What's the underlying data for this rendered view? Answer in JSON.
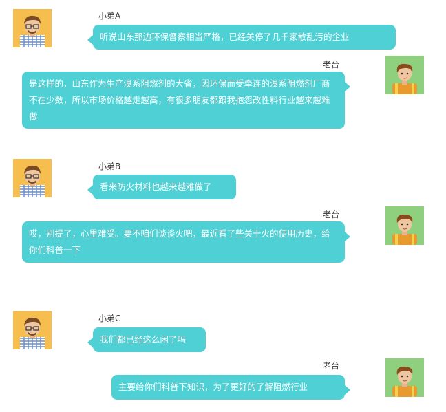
{
  "colors": {
    "bubble": "#4fd0d4",
    "text": "#ffffff",
    "name": "#333333",
    "avatar_bg_left": "#f5be4f",
    "avatar_bg_right": "#8fd07e"
  },
  "messages": [
    {
      "sender": "小弟A",
      "side": "left",
      "avatar": "young-man-glasses-avatar",
      "text": "听说山东那边环保督察相当严格，已经关停了几千家散乱污的企业"
    },
    {
      "sender": "老台",
      "side": "right",
      "avatar": "worker-avatar",
      "text": "是这样的，山东作为生产溴系阻燃剂的大省，因环保而受牵连的溴系阻燃剂厂商不在少数，所以市场价格越走越高，有很多朋友都跟我抱怨改性料行业越来越难做"
    },
    {
      "sender": "小弟B",
      "side": "left",
      "avatar": "young-man-glasses-avatar",
      "text": "看来防火材料也越来越难做了"
    },
    {
      "sender": "老台",
      "side": "right",
      "avatar": "worker-avatar",
      "text": "哎，别提了，心里难受。要不咱们谈谈火吧，最近看了些关于火的使用历史，给你们科普一下"
    },
    {
      "sender": "小弟C",
      "side": "left",
      "avatar": "young-man-glasses-avatar",
      "text": "我们都已经这么闲了吗"
    },
    {
      "sender": "老台",
      "side": "right",
      "avatar": "worker-avatar",
      "text": "主要给你们科普下知识，为了更好的了解阻燃行业"
    }
  ]
}
